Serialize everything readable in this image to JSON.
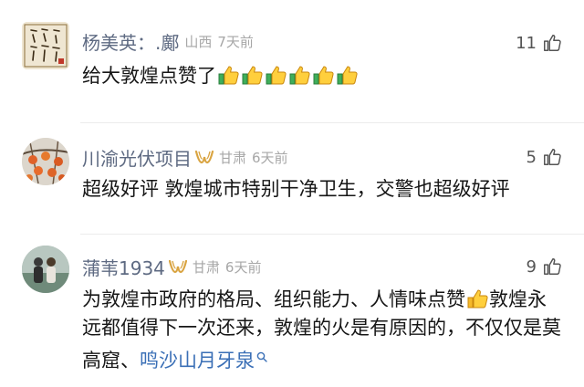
{
  "comments": [
    {
      "username": "杨美英：.鄺",
      "region": "山西",
      "time": "7天前",
      "likes": "11",
      "text": "给大敦煌点赞了",
      "thumb_emojis": 6,
      "has_badge": false
    },
    {
      "username": "川渝光伏项目",
      "region": "甘肃",
      "time": "6天前",
      "likes": "5",
      "text": "超级好评 敦煌城市特别干净卫生，交警也超级好评",
      "has_badge": true
    },
    {
      "username": "蒲苇1934",
      "region": "甘肃",
      "time": "6天前",
      "likes": "9",
      "text_part1": "为敦煌市政府的格局、组织能力、人情味点赞",
      "text_part2": "敦煌永远都值得下一次还来，敦煌的火是有原因的，不仅仅是莫高窟、",
      "link_text": "鸣沙山月牙泉",
      "has_badge": true
    }
  ],
  "icons": {
    "like": "thumbs-up-outline-icon",
    "badge": "gold-vip-badge-icon",
    "emoji": "thumbs-up-emoji",
    "search": "search-icon"
  },
  "colors": {
    "username": "#5e6a82",
    "meta": "#a7a7a7",
    "link": "#3a6fb6",
    "badge": "#d9a441"
  }
}
